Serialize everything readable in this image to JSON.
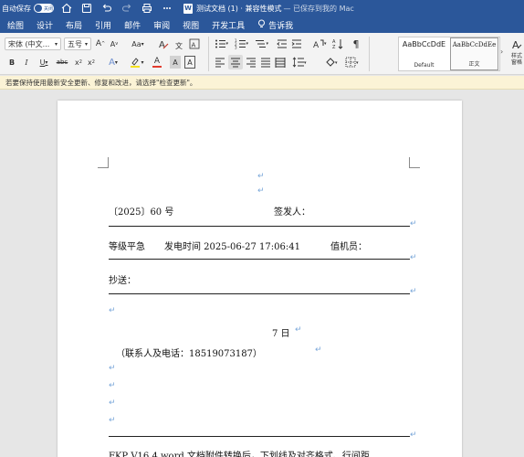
{
  "titlebar": {
    "autosave_label": "自动保存",
    "autosave_state": "关闭",
    "doc_icon_letter": "W",
    "doc_title": "测试文档 (1) · 兼容性模式",
    "saved_status": "— 已保存到我的 Mac",
    "icons": [
      "home-icon",
      "save-icon",
      "undo-icon",
      "redo-icon",
      "print-icon",
      "more-icon"
    ]
  },
  "menu": {
    "tabs": [
      "绘图",
      "设计",
      "布局",
      "引用",
      "邮件",
      "审阅",
      "视图",
      "开发工具",
      "告诉我"
    ],
    "tell_me_icon": "lightbulb-icon"
  },
  "ribbon": {
    "font_name": "宋体 (中文...",
    "font_size": "五号",
    "grow_font": "A",
    "shrink_font": "A",
    "change_case": "Aa",
    "bold": "B",
    "italic": "I",
    "underline": "U",
    "strikethrough": "abc",
    "subscript": "x",
    "superscript": "x",
    "text_effects": "A",
    "font_color": "A",
    "char_shading": "A",
    "highlight_color": "#f4e120",
    "font_color_value": "#e23b2e",
    "styles": [
      {
        "sample": "AaBbCcDdE",
        "name": "Default",
        "selected": false
      },
      {
        "sample": "AaBbCcDdEe",
        "name": "正文",
        "selected": true
      }
    ],
    "styles_pane_label": "样式窗格",
    "more_styles": "›"
  },
  "notice": {
    "text": "若要保持使用最新安全更新、修复和改进，请选择\"检查更新\"。"
  },
  "document": {
    "paragraph_mark": "↵",
    "doc_number": "〔2025〕60 号",
    "issuer_label": "签发人：",
    "urgency": "等级平急",
    "send_time": "发电时间 2025-06-27 17:06:41",
    "on_duty": "值机员：",
    "cc_label": "抄送：",
    "day": "7 日",
    "contact": "（联系人及电话：18519073187）",
    "footer_text": "FKP V16.4 word 文档附件转换后，下划线及对齐格式、行间距"
  }
}
